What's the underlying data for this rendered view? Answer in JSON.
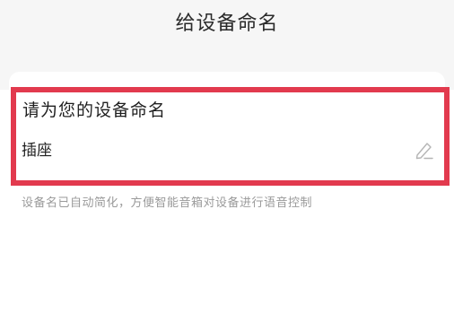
{
  "header": {
    "title": "给设备命名"
  },
  "card": {
    "heading": "请为您的设备命名",
    "name_value": "插座",
    "edit_icon": "pencil-edit-icon"
  },
  "hint": {
    "text": "设备名已自动简化，方便智能音箱对设备进行语音控制"
  },
  "colors": {
    "highlight": "#e23a4e",
    "top_background": "#f6f6f6",
    "hint_text": "#9a9a9a"
  }
}
